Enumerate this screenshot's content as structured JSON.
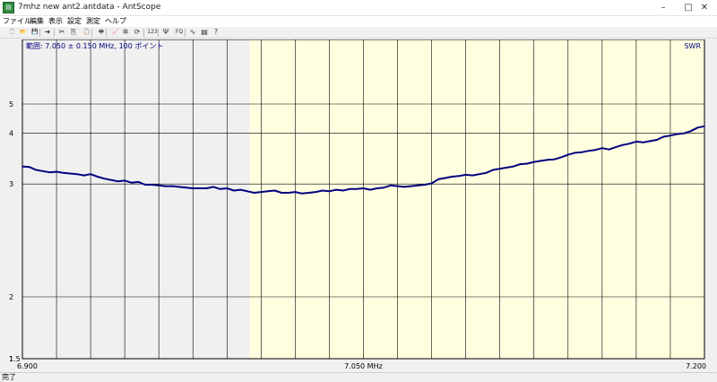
{
  "window": {
    "title": "7mhz new ant2.antdata - AntScope",
    "icon": "app-icon",
    "controls": [
      "minimize-icon",
      "maximize-icon",
      "close-icon"
    ]
  },
  "menu": {
    "items": [
      "ファイル",
      "編集",
      "表示",
      "設定",
      "測定",
      "ヘルプ"
    ]
  },
  "toolbar": {
    "buttons": [
      {
        "name": "new-icon",
        "glyph": "🗋"
      },
      {
        "name": "open-icon",
        "glyph": "📂"
      },
      {
        "name": "save-icon",
        "glyph": "💾"
      },
      {
        "name": "export-icon",
        "glyph": "➜"
      },
      {
        "name": "cut-icon",
        "glyph": "✂"
      },
      {
        "name": "copy-icon",
        "glyph": "⎘"
      },
      {
        "name": "paste-icon",
        "glyph": "📋"
      },
      {
        "name": "print-icon",
        "glyph": "🖶"
      },
      {
        "name": "chart-icon",
        "glyph": "📈"
      },
      {
        "name": "scan-icon",
        "glyph": "✲"
      },
      {
        "name": "refresh-icon",
        "glyph": "⟳"
      },
      {
        "name": "numeric-button",
        "glyph": "123"
      },
      {
        "name": "antenna-icon",
        "glyph": "Ψ"
      },
      {
        "name": "fq-button",
        "glyph": "FQ"
      },
      {
        "name": "sweep-icon",
        "glyph": "∿"
      },
      {
        "name": "table-icon",
        "glyph": "▤"
      },
      {
        "name": "help-icon",
        "glyph": "?"
      }
    ]
  },
  "status": {
    "text": "完了"
  },
  "colors": {
    "plot_left_bg": "#f0f0f0",
    "plot_band_bg": "#ffffe0",
    "grid": "#000000",
    "curve": "#000080",
    "label_text": "#000080"
  },
  "chart_data": {
    "type": "line",
    "range_text": "範囲: 7.050 ± 0.150 MHz, 100 ポイント",
    "series_label": "SWR",
    "x_unit": "MHz",
    "xlim": [
      6.9,
      7.2
    ],
    "ylim": [
      1,
      6
    ],
    "y_scale": "swr",
    "y_ticks": [
      1,
      1.5,
      2,
      3,
      4,
      5
    ],
    "x_tick_labels": [
      {
        "value": 6.9,
        "label": "6.900"
      },
      {
        "value": 7.05,
        "label": "7.050 MHz"
      },
      {
        "value": 7.2,
        "label": "7.200"
      }
    ],
    "band_highlight": [
      7.0,
      7.2
    ],
    "grid": true,
    "x": [
      6.9,
      6.903,
      6.906,
      6.909,
      6.912,
      6.915,
      6.918,
      6.921,
      6.924,
      6.927,
      6.93,
      6.933,
      6.936,
      6.939,
      6.942,
      6.945,
      6.948,
      6.951,
      6.954,
      6.957,
      6.96,
      6.963,
      6.966,
      6.969,
      6.972,
      6.975,
      6.978,
      6.981,
      6.984,
      6.987,
      6.99,
      6.993,
      6.996,
      6.999,
      7.002,
      7.005,
      7.008,
      7.011,
      7.014,
      7.017,
      7.02,
      7.023,
      7.026,
      7.029,
      7.032,
      7.035,
      7.038,
      7.041,
      7.044,
      7.047,
      7.05,
      7.053,
      7.056,
      7.059,
      7.062,
      7.065,
      7.068,
      7.071,
      7.074,
      7.077,
      7.08,
      7.083,
      7.086,
      7.089,
      7.092,
      7.095,
      7.098,
      7.101,
      7.104,
      7.107,
      7.11,
      7.113,
      7.116,
      7.119,
      7.122,
      7.125,
      7.128,
      7.131,
      7.134,
      7.137,
      7.14,
      7.143,
      7.146,
      7.149,
      7.152,
      7.155,
      7.158,
      7.161,
      7.164,
      7.167,
      7.17,
      7.173,
      7.176,
      7.179,
      7.182,
      7.185,
      7.188,
      7.191,
      7.194,
      7.197,
      7.2
    ],
    "values": [
      3.28,
      3.27,
      3.22,
      3.2,
      3.18,
      3.19,
      3.17,
      3.16,
      3.15,
      3.13,
      3.15,
      3.11,
      3.08,
      3.06,
      3.04,
      3.05,
      3.02,
      3.03,
      2.99,
      2.99,
      2.98,
      2.97,
      2.97,
      2.96,
      2.95,
      2.94,
      2.94,
      2.94,
      2.96,
      2.93,
      2.94,
      2.91,
      2.92,
      2.9,
      2.88,
      2.89,
      2.9,
      2.91,
      2.88,
      2.88,
      2.89,
      2.87,
      2.88,
      2.89,
      2.91,
      2.9,
      2.92,
      2.91,
      2.93,
      2.93,
      2.94,
      2.92,
      2.94,
      2.95,
      2.98,
      2.97,
      2.96,
      2.97,
      2.98,
      2.99,
      3.01,
      3.07,
      3.09,
      3.11,
      3.12,
      3.14,
      3.13,
      3.15,
      3.17,
      3.22,
      3.24,
      3.26,
      3.28,
      3.32,
      3.33,
      3.36,
      3.38,
      3.4,
      3.41,
      3.45,
      3.5,
      3.54,
      3.55,
      3.58,
      3.6,
      3.64,
      3.61,
      3.66,
      3.71,
      3.74,
      3.79,
      3.77,
      3.8,
      3.83,
      3.91,
      3.94,
      3.98,
      4.0,
      4.06,
      4.16,
      4.2
    ]
  }
}
